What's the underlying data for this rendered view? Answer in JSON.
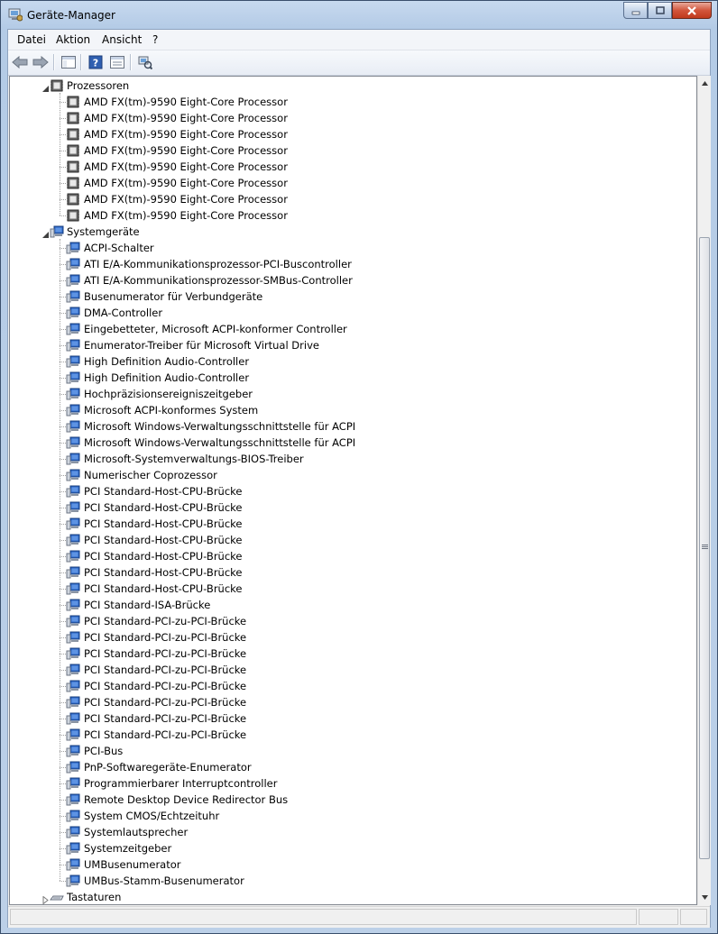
{
  "window": {
    "title": "Geräte-Manager"
  },
  "menubar": {
    "items": [
      "Datei",
      "Aktion",
      "Ansicht",
      "?"
    ]
  },
  "toolbar": {
    "buttons": [
      "back-icon",
      "forward-icon",
      "show-hide-console-tree-icon",
      "help-icon",
      "properties-icon",
      "scan-hardware-icon"
    ]
  },
  "tree": {
    "categories": [
      {
        "label": "Prozessoren",
        "expanded": true,
        "icon": "processor-icon",
        "items": [
          "AMD FX(tm)-9590 Eight-Core Processor",
          "AMD FX(tm)-9590 Eight-Core Processor",
          "AMD FX(tm)-9590 Eight-Core Processor",
          "AMD FX(tm)-9590 Eight-Core Processor",
          "AMD FX(tm)-9590 Eight-Core Processor",
          "AMD FX(tm)-9590 Eight-Core Processor",
          "AMD FX(tm)-9590 Eight-Core Processor",
          "AMD FX(tm)-9590 Eight-Core Processor"
        ]
      },
      {
        "label": "Systemgeräte",
        "expanded": true,
        "icon": "system-device-icon",
        "items": [
          "ACPI-Schalter",
          "ATI E/A-Kommunikationsprozessor-PCI-Buscontroller",
          "ATI E/A-Kommunikationsprozessor-SMBus-Controller",
          "Busenumerator für Verbundgeräte",
          "DMA-Controller",
          "Eingebetteter, Microsoft ACPI-konformer Controller",
          "Enumerator-Treiber für Microsoft Virtual Drive",
          "High Definition Audio-Controller",
          "High Definition Audio-Controller",
          "Hochpräzisionsereigniszeitgeber",
          "Microsoft ACPI-konformes System",
          "Microsoft Windows-Verwaltungsschnittstelle für ACPI",
          "Microsoft Windows-Verwaltungsschnittstelle für ACPI",
          "Microsoft-Systemverwaltungs-BIOS-Treiber",
          "Numerischer Coprozessor",
          "PCI Standard-Host-CPU-Brücke",
          "PCI Standard-Host-CPU-Brücke",
          "PCI Standard-Host-CPU-Brücke",
          "PCI Standard-Host-CPU-Brücke",
          "PCI Standard-Host-CPU-Brücke",
          "PCI Standard-Host-CPU-Brücke",
          "PCI Standard-Host-CPU-Brücke",
          "PCI Standard-ISA-Brücke",
          "PCI Standard-PCI-zu-PCI-Brücke",
          "PCI Standard-PCI-zu-PCI-Brücke",
          "PCI Standard-PCI-zu-PCI-Brücke",
          "PCI Standard-PCI-zu-PCI-Brücke",
          "PCI Standard-PCI-zu-PCI-Brücke",
          "PCI Standard-PCI-zu-PCI-Brücke",
          "PCI Standard-PCI-zu-PCI-Brücke",
          "PCI Standard-PCI-zu-PCI-Brücke",
          "PCI-Bus",
          "PnP-Softwaregeräte-Enumerator",
          "Programmierbarer Interruptcontroller",
          "Remote Desktop Device Redirector Bus",
          "System CMOS/Echtzeituhr",
          "Systemlautsprecher",
          "Systemzeitgeber",
          "UMBusenumerator",
          "UMBus-Stamm-Busenumerator"
        ]
      },
      {
        "label": "Tastaturen",
        "expanded": false,
        "icon": "keyboard-icon",
        "items": []
      }
    ]
  },
  "colors": {
    "title_gradient_top": "#c7d9ef",
    "close_button": "#c0391c",
    "tree_background": "#ffffff"
  }
}
